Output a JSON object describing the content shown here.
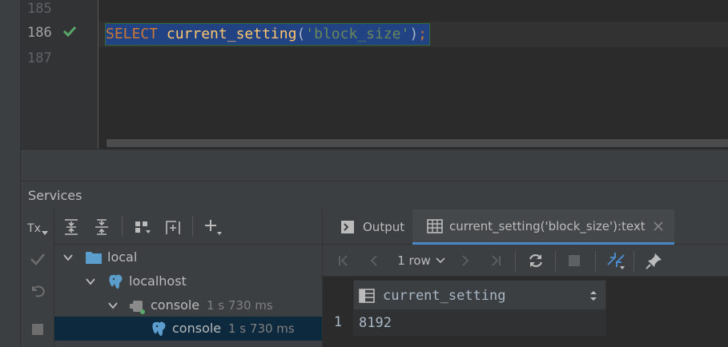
{
  "editor": {
    "lines": [
      {
        "num": "185",
        "code": ""
      },
      {
        "num": "186",
        "code": "SELECT current_setting('block_size');",
        "status_icon": "check-icon"
      },
      {
        "num": "187",
        "code": ""
      }
    ],
    "tokens": {
      "keyword": "SELECT",
      "function": "current_setting",
      "open_paren": "(",
      "string": "'block_size'",
      "close_paren": ")",
      "semicolon": ";"
    }
  },
  "services": {
    "title": "Services",
    "side_buttons": [
      "Tx",
      "commit-icon",
      "rollback-icon",
      "stop-icon"
    ],
    "toolbar_icons": [
      "expand-all-icon",
      "collapse-all-icon",
      "group-by-icon",
      "add-service-icon",
      "add-icon"
    ],
    "tree": [
      {
        "label": "local",
        "icon": "folder-icon",
        "meta": ""
      },
      {
        "label": "localhost",
        "icon": "postgresql-icon",
        "meta": ""
      },
      {
        "label": "console",
        "icon": "console-icon",
        "meta": "1 s 730 ms"
      },
      {
        "label": "console",
        "icon": "postgresql-icon",
        "meta": "1 s 730 ms",
        "selected": true
      }
    ]
  },
  "results": {
    "tabs": [
      {
        "label": "Output",
        "icon": "output-icon"
      },
      {
        "label": "current_setting('block_size'):text",
        "icon": "table-icon",
        "active": true
      }
    ],
    "toolbar": {
      "row_count": "1 row",
      "icons": [
        "first-page-icon",
        "prev-page-icon",
        "next-page-icon",
        "last-page-icon",
        "refresh-icon",
        "stop-icon",
        "compare-icon",
        "pin-icon"
      ]
    },
    "grid": {
      "column": "current_setting",
      "rows": [
        {
          "num": "1",
          "value": "8192"
        }
      ]
    }
  },
  "colors": {
    "background": "#2b2b2b",
    "panel": "#3c3f41",
    "selection": "#214283",
    "accent": "#4a88c7",
    "keyword": "#cc7832",
    "function": "#ffc66d",
    "string": "#6a8759"
  }
}
